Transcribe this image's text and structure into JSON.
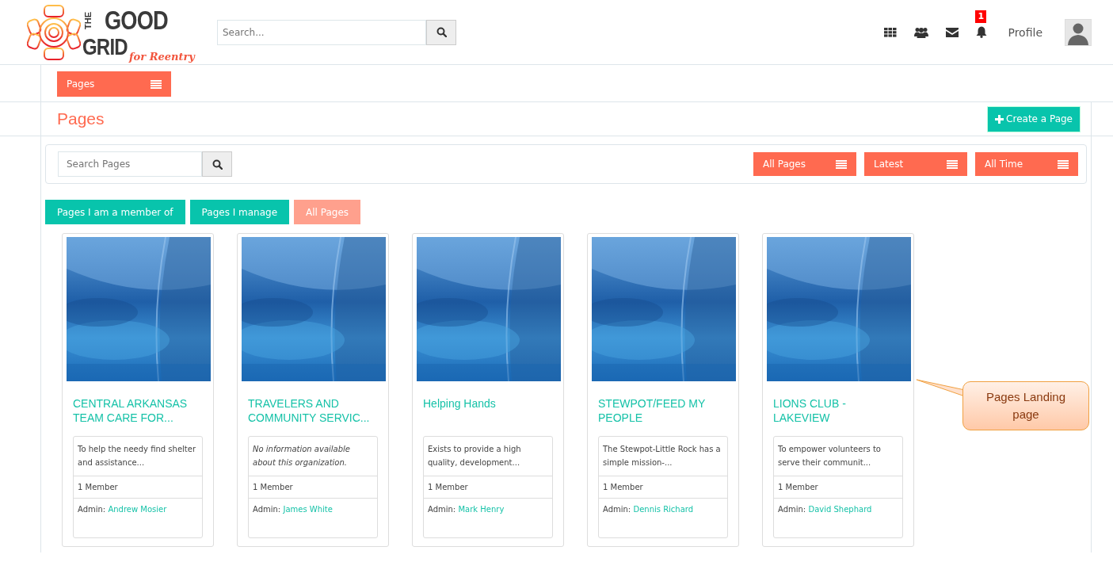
{
  "logo": {
    "the": "THE",
    "good": "GOOD",
    "grid": "GRID",
    "tagline": "for Reentry"
  },
  "search": {
    "placeholder": "Search..."
  },
  "nav": {
    "notification_count": "1",
    "profile": "Profile"
  },
  "section_menu": {
    "label": "Pages"
  },
  "page_title": "Pages",
  "create_button": "Create a Page",
  "filters": {
    "search_placeholder": "Search Pages",
    "dropdowns": [
      "All Pages",
      "Latest",
      "All Time"
    ]
  },
  "tabs": [
    {
      "label": "Pages I am a member of",
      "selected": false
    },
    {
      "label": "Pages I manage",
      "selected": false
    },
    {
      "label": "All Pages",
      "selected": true
    }
  ],
  "cards": [
    {
      "title": "CENTRAL ARKANSAS TEAM CARE FOR...",
      "description": "To help the needy find shelter and assistance...",
      "italic": false,
      "members": "1 Member",
      "admin_label": "Admin:",
      "admin": "Andrew Mosier"
    },
    {
      "title": "TRAVELERS AND COMMUNITY SERVIC...",
      "description": "No information available about this organization.",
      "italic": true,
      "members": "1 Member",
      "admin_label": "Admin:",
      "admin": "James White"
    },
    {
      "title": "Helping Hands",
      "description": "Exists to provide a high quality, development...",
      "italic": false,
      "members": "1 Member",
      "admin_label": "Admin:",
      "admin": "Mark Henry"
    },
    {
      "title": "STEWPOT/FEED MY PEOPLE",
      "description": "The Stewpot-Little Rock has a simple mission-...",
      "italic": false,
      "members": "1 Member",
      "admin_label": "Admin:",
      "admin": "Dennis Richard"
    },
    {
      "title": "LIONS CLUB - LAKEVIEW",
      "description": "To empower volunteers to serve their communit...",
      "italic": false,
      "members": "1 Member",
      "admin_label": "Admin:",
      "admin": "David Shephard"
    }
  ],
  "callout": "Pages Landing page"
}
